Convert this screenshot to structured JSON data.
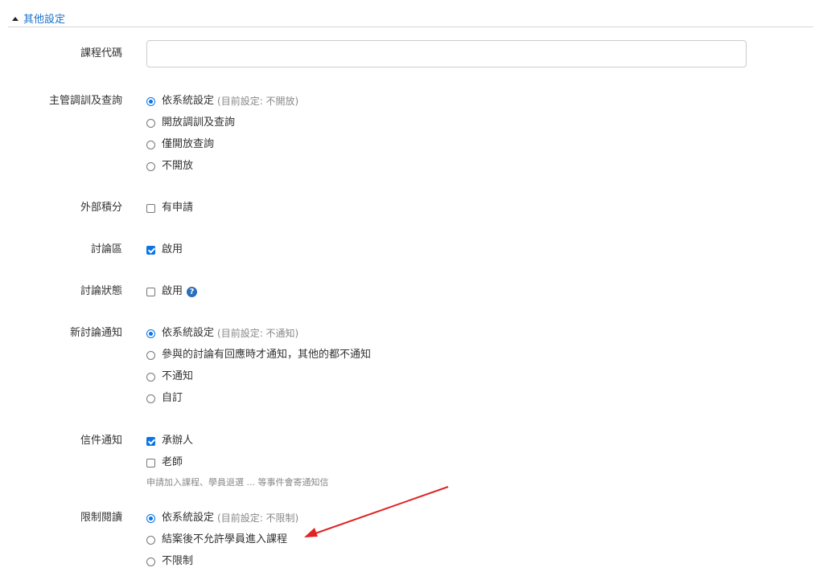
{
  "section": {
    "title": "其他設定"
  },
  "course_code": {
    "label": "課程代碼",
    "value": ""
  },
  "supervisor": {
    "label": "主管調訓及查詢",
    "options": [
      {
        "label": "依系統設定",
        "note": "(目前設定: 不開放)",
        "selected": true
      },
      {
        "label": "開放調訓及查詢",
        "selected": false
      },
      {
        "label": "僅開放查詢",
        "selected": false
      },
      {
        "label": "不開放",
        "selected": false
      }
    ]
  },
  "external_credit": {
    "label": "外部積分",
    "option": "有申請",
    "checked": false
  },
  "discussion": {
    "label": "討論區",
    "option": "啟用",
    "checked": true
  },
  "discussion_status": {
    "label": "討論狀態",
    "option": "啟用",
    "checked": false,
    "help_icon": "question-circle-icon",
    "help_glyph": "?"
  },
  "new_discussion_notify": {
    "label": "新討論通知",
    "options": [
      {
        "label": "依系統設定",
        "note": "(目前設定: 不通知)",
        "selected": true
      },
      {
        "label": "參與的討論有回應時才通知，其他的都不通知",
        "selected": false
      },
      {
        "label": "不通知",
        "selected": false
      },
      {
        "label": "自訂",
        "selected": false
      }
    ]
  },
  "mail_notify": {
    "label": "信件通知",
    "options": [
      {
        "label": "承辦人",
        "checked": true
      },
      {
        "label": "老師",
        "checked": false
      }
    ],
    "help": "申請加入課程、學員退選 ... 等事件會寄通知信"
  },
  "restrict_reading": {
    "label": "限制閱讀",
    "options": [
      {
        "label": "依系統設定",
        "note": "(目前設定: 不限制)",
        "selected": true
      },
      {
        "label": "結案後不允許學員進入課程",
        "selected": false
      },
      {
        "label": "不限制",
        "selected": false
      }
    ]
  },
  "colors": {
    "accent": "#0b74e5",
    "link": "#1a73c9",
    "annotation_arrow": "#e02424"
  }
}
